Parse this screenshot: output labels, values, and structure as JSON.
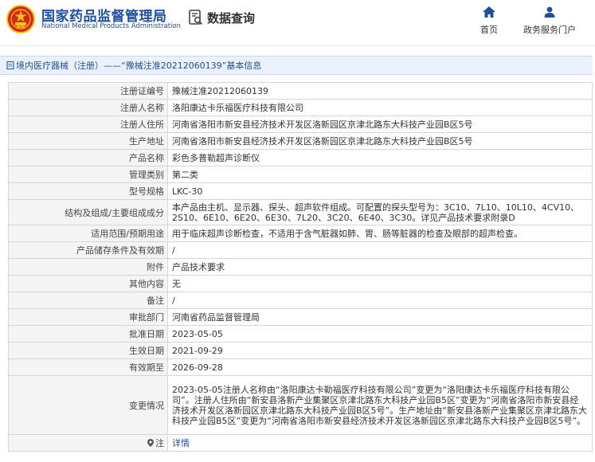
{
  "header": {
    "brand_cn": "国家药品监督管理局",
    "brand_en": "National Medical Products Administration",
    "query_label": "数据查询",
    "nav": [
      {
        "label": "首页",
        "icon": "home-icon"
      },
      {
        "label": "政务服务门户",
        "icon": "user-icon"
      }
    ]
  },
  "title": "境内医疗器械（注册）——“豫械注准20212060139”基本信息",
  "rows": [
    {
      "label": "注册证编号",
      "value": "豫械注准20212060139"
    },
    {
      "label": "注册人名称",
      "value": "洛阳康达卡乐福医疗科技有限公司"
    },
    {
      "label": "注册人住所",
      "value": "河南省洛阳市新安县经济技术开发区洛新园区京津北路东大科技产业园B区5号"
    },
    {
      "label": "生产地址",
      "value": "河南省洛阳市新安县经济技术开发区洛新园区京津北路东大科技产业园B区5号"
    },
    {
      "label": "产品名称",
      "value": "彩色多普勒超声诊断仪"
    },
    {
      "label": "管理类别",
      "value": "第二类"
    },
    {
      "label": "型号规格",
      "value": "LKC-30"
    },
    {
      "label": "结构及组成/主要组成成分",
      "value": "本产品由主机、显示器、探头、超声软件组成。可配置的探头型号为：3C10、7L10、10L10、4CV10、2S10、6E10、6E20、6E30、7L20、3C20、6E40、3C30。详见产品技术要求附录D"
    },
    {
      "label": "适用范围/预期用途",
      "value": "用于临床超声诊断检查，不适用于含气脏器如肺、胃、肠等脏器的检查及眼部的超声检查。"
    },
    {
      "label": "产品储存条件及有效期",
      "value": "/"
    },
    {
      "label": "附件",
      "value": "产品技术要求"
    },
    {
      "label": "其他内容",
      "value": "无"
    },
    {
      "label": "备注",
      "value": "/"
    },
    {
      "label": "审批部门",
      "value": "河南省药品监督管理局"
    },
    {
      "label": "批准日期",
      "value": "2023-05-05"
    },
    {
      "label": "生效日期",
      "value": "2021-09-29"
    },
    {
      "label": "有效期至",
      "value": "2026-09-28"
    },
    {
      "label": "变更情况",
      "value": "2023-05-05注册人名称由“洛阳康达卡勒福医疗科技有限公司”变更为“洛阳康达卡乐福医疗科技有限公司”。注册人住所由“新安县洛新产业集聚区京津北路东大科技产业园B5区”变更为“河南省洛阳市新安县经济技术开发区洛新园区京津北路东大科技产业园B区5号”。生产地址由“新安县洛新产业集聚区京津北路东大科技产业园B5区”变更为“河南省洛阳市新安县经济技术开发区洛新园区京津北路东大科技产业园B区5号”。"
    },
    {
      "label": "注",
      "value": "详情"
    }
  ],
  "colors": {
    "brand": "#1f4f9c",
    "label_bg": "#f4f4f4",
    "titlebar_bg": "#eaf1fb",
    "emblem_red": "#d7261e",
    "emblem_gold": "#f5c518"
  }
}
